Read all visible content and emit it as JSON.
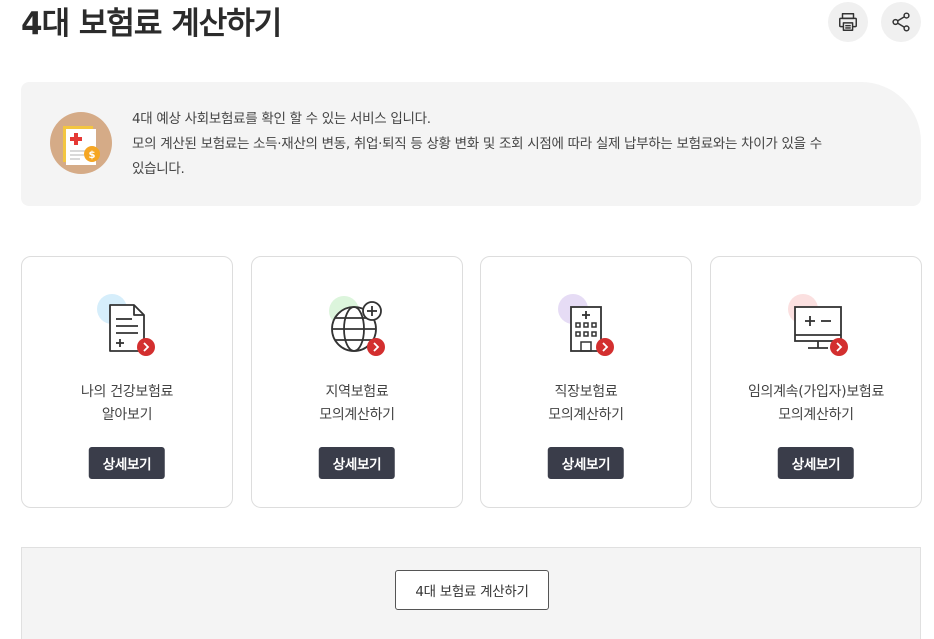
{
  "page": {
    "title": "4대 보험료 계산하기"
  },
  "toolbar": {
    "print_icon": "printer-icon",
    "share_icon": "share-icon"
  },
  "info": {
    "line1": "4대 예상 사회보험료를 확인 할 수 있는 서비스 입니다.",
    "line2": "모의 계산된 보험료는 소득·재산의 변동, 취업·퇴직 등 상황 변화 및 조회 시점에 따라 실제 납부하는 보험료와는 차이가 있을 수",
    "line3": "있습니다.",
    "icon": "insurance-document-coin-icon"
  },
  "cards": [
    {
      "line1": "나의 건강보험료",
      "line2": "알아보기",
      "button": "상세보기",
      "icon": "document-plus-icon",
      "accent": "#d6eefb"
    },
    {
      "line1": "지역보험료",
      "line2": "모의계산하기",
      "button": "상세보기",
      "icon": "globe-plus-icon",
      "accent": "#dcf5dc"
    },
    {
      "line1": "직장보험료",
      "line2": "모의계산하기",
      "button": "상세보기",
      "icon": "building-icon",
      "accent": "#e6dcf5"
    },
    {
      "line1": "임의계속(가입자)보험료",
      "line2": "모의계산하기",
      "button": "상세보기",
      "icon": "calculator-monitor-icon",
      "accent": "#fbe0e0"
    }
  ],
  "bottom": {
    "button": "4대 보험료 계산하기"
  },
  "colors": {
    "dark_button": "#3a3d4a",
    "badge_red": "#d32f2f",
    "panel_bg": "#f4f4f4"
  }
}
